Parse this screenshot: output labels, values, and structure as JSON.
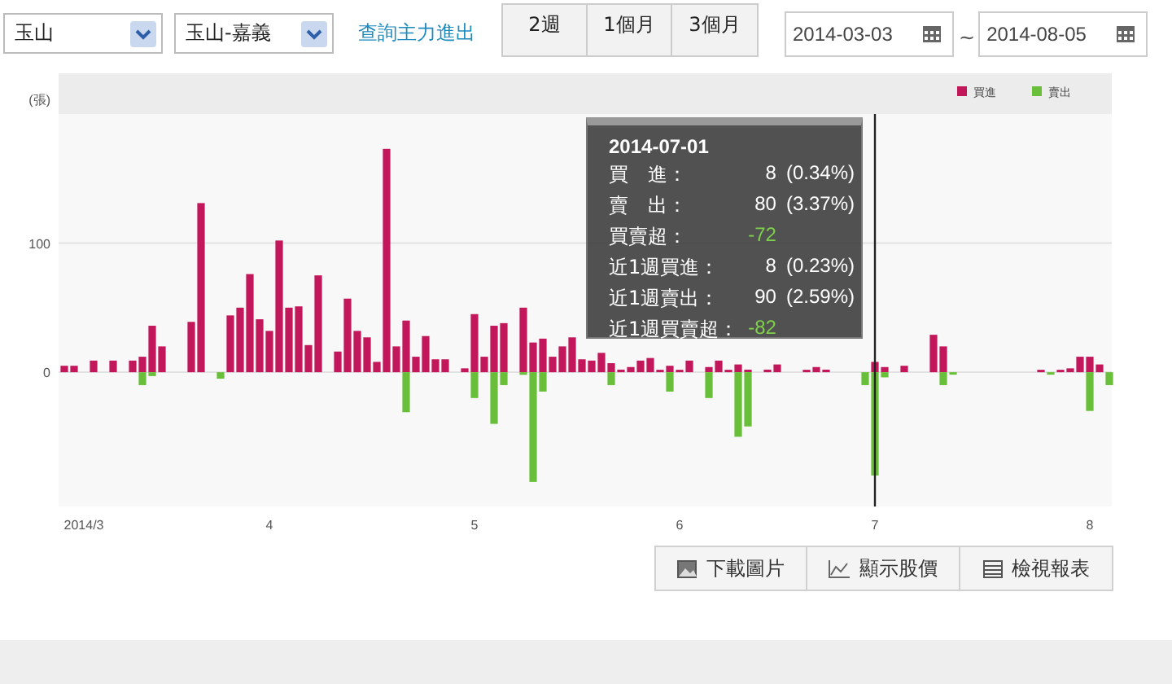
{
  "toolbar": {
    "stock_select": "玉山",
    "branch_select": "玉山-嘉義",
    "query_link": "查詢主力進出",
    "ranges": [
      {
        "label": "2週",
        "selected": false
      },
      {
        "label": "1個月",
        "selected": false
      },
      {
        "label": "3個月",
        "selected": false
      }
    ],
    "start_date": "2014-03-03",
    "date_separator": "~",
    "end_date": "2014-08-05"
  },
  "chart": {
    "chart_data": {
      "type": "bar",
      "ylabel": "(張)",
      "legend": true,
      "categories": [
        null,
        null,
        "2014/3",
        null,
        null,
        null,
        null,
        null,
        null,
        null,
        null,
        null,
        null,
        null,
        null,
        null,
        null,
        null,
        null,
        null,
        null,
        "4",
        null,
        null,
        null,
        null,
        null,
        null,
        null,
        null,
        null,
        null,
        null,
        null,
        null,
        null,
        null,
        null,
        null,
        null,
        null,
        null,
        "5",
        null,
        null,
        null,
        null,
        null,
        null,
        null,
        null,
        null,
        null,
        null,
        null,
        null,
        null,
        null,
        null,
        null,
        null,
        null,
        null,
        "6",
        null,
        null,
        null,
        null,
        null,
        null,
        null,
        null,
        null,
        null,
        null,
        null,
        null,
        null,
        null,
        null,
        null,
        null,
        null,
        "7",
        null,
        null,
        null,
        null,
        null,
        null,
        null,
        null,
        null,
        null,
        null,
        null,
        null,
        null,
        null,
        null,
        null,
        null,
        null,
        null,
        null,
        "8",
        null,
        null
      ],
      "ylim": [
        -104,
        200
      ],
      "yticks": [
        0,
        100
      ],
      "series": [
        {
          "name": "買進",
          "color": "#c2185b",
          "values": [
            5,
            5,
            null,
            9,
            null,
            9,
            null,
            9,
            12,
            36,
            20,
            null,
            null,
            39,
            131,
            null,
            null,
            44,
            50,
            76,
            41,
            32,
            102,
            50,
            51,
            21,
            75,
            null,
            16,
            57,
            32,
            27,
            8,
            173,
            20,
            40,
            12,
            28,
            10,
            10,
            null,
            3,
            45,
            12,
            36,
            38,
            null,
            50,
            23,
            26,
            12,
            20,
            27,
            10,
            9,
            15,
            7,
            2,
            4,
            9,
            11,
            1,
            5,
            1,
            9,
            null,
            4,
            9,
            1,
            6,
            2,
            null,
            2,
            6,
            null,
            null,
            1,
            4,
            2,
            null,
            null,
            null,
            null,
            8,
            4,
            null,
            5,
            null,
            null,
            29,
            20,
            null,
            null,
            null,
            null,
            null,
            null,
            null,
            null,
            null,
            1,
            null,
            1,
            3,
            12,
            12,
            6,
            null
          ]
        },
        {
          "name": "賣出",
          "color": "#6abf3a",
          "values": [
            null,
            null,
            null,
            null,
            null,
            null,
            null,
            null,
            -10,
            -3,
            null,
            null,
            null,
            null,
            null,
            null,
            -5,
            null,
            null,
            null,
            null,
            null,
            null,
            null,
            null,
            null,
            null,
            null,
            null,
            null,
            null,
            null,
            null,
            null,
            null,
            -31,
            null,
            null,
            null,
            null,
            null,
            null,
            -20,
            null,
            -40,
            -10,
            null,
            -2,
            -85,
            -15,
            null,
            null,
            null,
            null,
            null,
            null,
            -10,
            null,
            null,
            null,
            null,
            null,
            -15,
            null,
            null,
            null,
            -20,
            null,
            null,
            -50,
            -42,
            null,
            null,
            null,
            null,
            null,
            null,
            null,
            null,
            null,
            null,
            null,
            -10,
            -80,
            -4,
            null,
            null,
            null,
            null,
            null,
            -10,
            -1,
            null,
            null,
            null,
            null,
            null,
            null,
            null,
            null,
            null,
            -1,
            null,
            null,
            null,
            -30,
            null,
            -10
          ]
        }
      ],
      "ref_lines": [
        {
          "axis": "x",
          "value": "7"
        }
      ]
    }
  },
  "tooltip": {
    "date": "2014-07-01",
    "rows": [
      {
        "kind": "share",
        "label": "買　進：",
        "value": "8",
        "percent": "(0.34%)"
      },
      {
        "kind": "share",
        "label": "賣　出：",
        "value": "80",
        "percent": "(3.37%)"
      },
      {
        "kind": "net",
        "label": "買賣超：",
        "value": "-72"
      },
      {
        "kind": "share",
        "label": "近1週買進：",
        "value": "8",
        "percent": "(0.23%)"
      },
      {
        "kind": "share",
        "label": "近1週賣出：",
        "value": "90",
        "percent": "(2.59%)"
      },
      {
        "kind": "net",
        "label": "近1週買賣超：",
        "value": "-82"
      }
    ]
  },
  "actions": [
    {
      "kind": "image",
      "label": "下載圖片"
    },
    {
      "kind": "line",
      "label": "顯示股價"
    },
    {
      "kind": "table",
      "label": "檢視報表"
    }
  ]
}
